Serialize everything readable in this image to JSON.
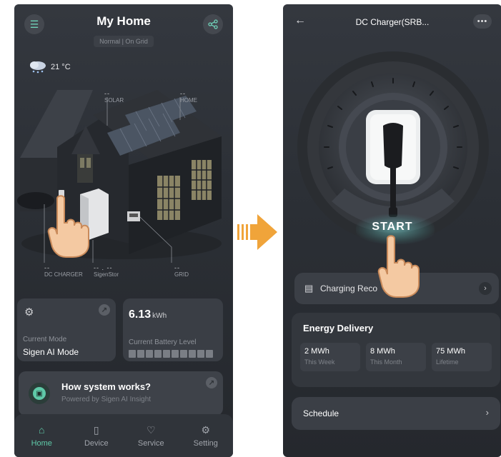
{
  "left_screen": {
    "title": "My Home",
    "status": "Normal | On Grid",
    "weather": {
      "icon": "cloud-snow-icon",
      "temperature": "21 °C"
    },
    "scene_labels": {
      "solar": {
        "value": "--",
        "label": "SOLAR"
      },
      "home": {
        "value": "--",
        "label": "HOME"
      },
      "dc_charger": {
        "value": "--",
        "label": "DC CHARGER"
      },
      "sigenstor": {
        "value": "-- . --",
        "label": "SigenStor"
      },
      "grid": {
        "value": "--",
        "label": "GRID"
      }
    },
    "mode_card": {
      "label": "Current Mode",
      "value": "Sigen AI Mode"
    },
    "battery_card": {
      "value": "6.13",
      "unit": "kWh",
      "label": "Current Battery Level"
    },
    "how_card": {
      "title": "How system works?",
      "subtitle": "Powered by Sigen AI Insight"
    },
    "nav": [
      {
        "label": "Home",
        "icon": "home-icon",
        "active": true
      },
      {
        "label": "Device",
        "icon": "device-icon",
        "active": false
      },
      {
        "label": "Service",
        "icon": "service-icon",
        "active": false
      },
      {
        "label": "Setting",
        "icon": "gear-icon",
        "active": false
      }
    ]
  },
  "right_screen": {
    "title": "DC Charger(SRB...",
    "start_label": "START",
    "charging_record_label": "Charging Reco",
    "energy_delivery": {
      "title": "Energy Delivery",
      "stats": [
        {
          "value": "2 MWh",
          "label": "This Week"
        },
        {
          "value": "8 MWh",
          "label": "This Month"
        },
        {
          "value": "75 MWh",
          "label": "Lifetime"
        }
      ]
    },
    "schedule_label": "Schedule"
  },
  "colors": {
    "accent": "#5fc9a8",
    "background": "#2b2f35",
    "card": "#3a3e45",
    "arrow": "#f0a43a",
    "hand": "#f4c9a2"
  }
}
